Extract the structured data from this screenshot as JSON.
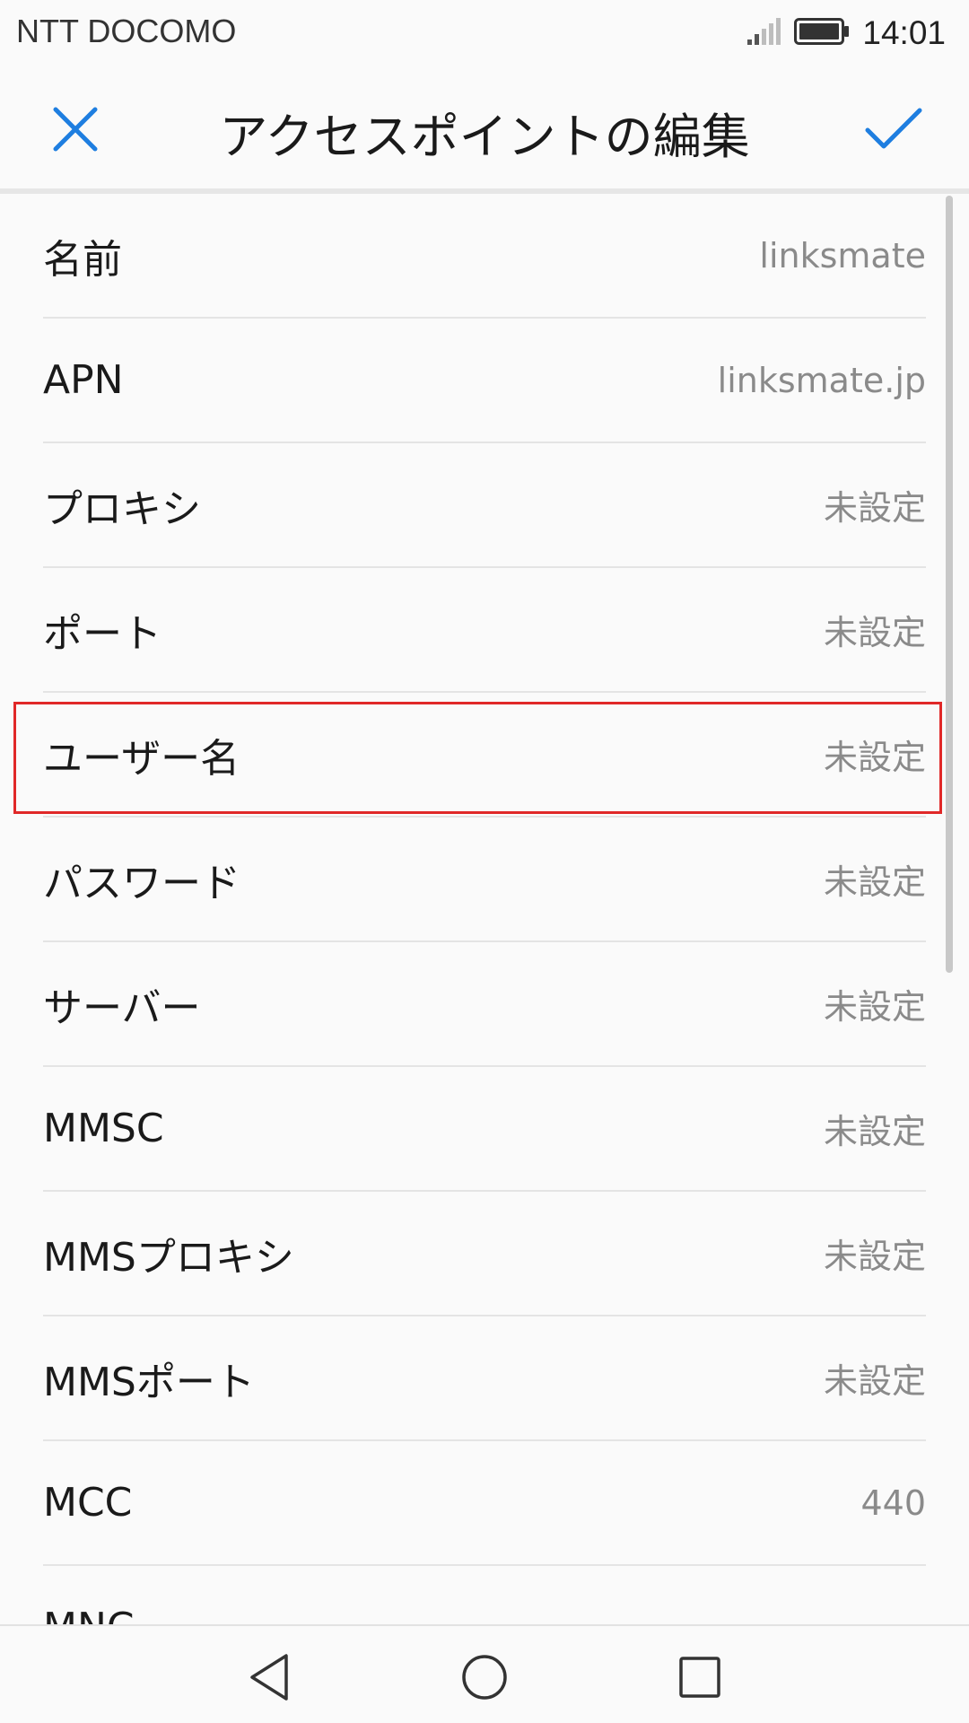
{
  "status_bar": {
    "carrier": "NTT DOCOMO",
    "time": "14:01",
    "icons": [
      "signal-icon",
      "battery-icon"
    ]
  },
  "toolbar": {
    "title": "アクセスポイントの編集",
    "close_icon": "close-icon",
    "confirm_icon": "check-icon",
    "accent_color": "#1e7ee0"
  },
  "apn_fields": [
    {
      "label": "名前",
      "value": "linksmate"
    },
    {
      "label": "APN",
      "value": "linksmate.jp"
    },
    {
      "label": "プロキシ",
      "value": "未設定"
    },
    {
      "label": "ポート",
      "value": "未設定"
    },
    {
      "label": "ユーザー名",
      "value": "未設定"
    },
    {
      "label": "パスワード",
      "value": "未設定"
    },
    {
      "label": "サーバー",
      "value": "未設定"
    },
    {
      "label": "MMSC",
      "value": "未設定"
    },
    {
      "label": "MMSプロキシ",
      "value": "未設定"
    },
    {
      "label": "MMSポート",
      "value": "未設定"
    },
    {
      "label": "MCC",
      "value": "440"
    },
    {
      "label": "MNC",
      "value": ""
    }
  ],
  "highlight_color": "#e02828",
  "nav_bar": {
    "icons": [
      "back-icon",
      "home-icon",
      "recents-icon"
    ]
  }
}
